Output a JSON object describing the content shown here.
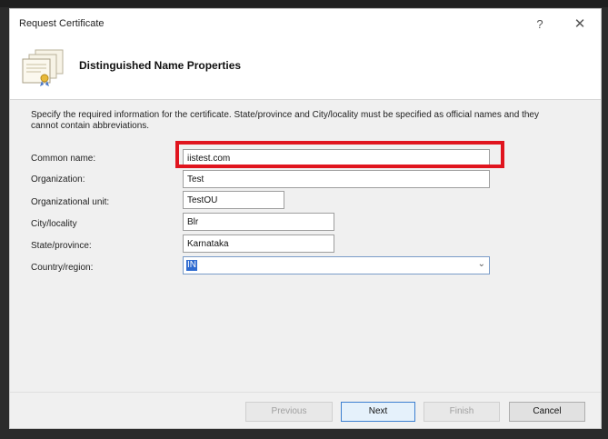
{
  "window": {
    "title": "Request Certificate",
    "help_glyph": "?",
    "close_glyph": "✕"
  },
  "header": {
    "title": "Distinguished Name Properties",
    "icon": "certificate-stack-icon"
  },
  "instructions": "Specify the required information for the certificate. State/province and City/locality must be specified as official names and they cannot contain abbreviations.",
  "fields": {
    "common_name": {
      "label": "Common name:",
      "value": "iistest.com"
    },
    "organization": {
      "label": "Organization:",
      "value": "Test"
    },
    "organizational_unit": {
      "label": "Organizational unit:",
      "value": "TestOU"
    },
    "city": {
      "label": "City/locality",
      "value": "Blr"
    },
    "state": {
      "label": "State/province:",
      "value": "Karnataka"
    },
    "country": {
      "label": "Country/region:",
      "value": "IN"
    }
  },
  "buttons": {
    "previous": "Previous",
    "next": "Next",
    "finish": "Finish",
    "cancel": "Cancel"
  },
  "colors": {
    "highlight": "#e0141e",
    "selection": "#2f6bd0"
  }
}
